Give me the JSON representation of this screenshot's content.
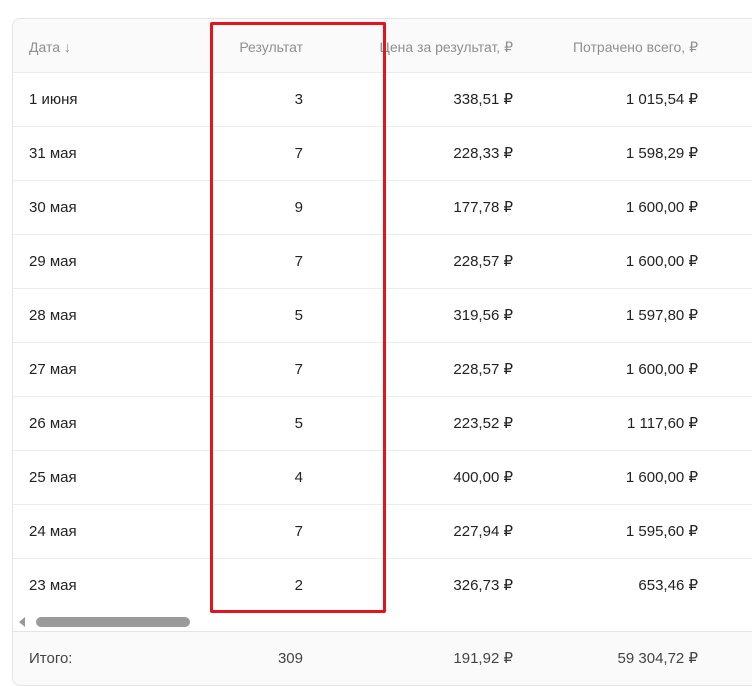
{
  "table": {
    "headers": {
      "date": "Дата ↓",
      "result": "Результат",
      "price": "Цена за результат, ₽",
      "spent": "Потрачено всего, ₽"
    },
    "rows": [
      {
        "date": "1 июня",
        "result": "3",
        "price": "338,51 ₽",
        "spent": "1 015,54 ₽"
      },
      {
        "date": "31 мая",
        "result": "7",
        "price": "228,33 ₽",
        "spent": "1 598,29 ₽"
      },
      {
        "date": "30 мая",
        "result": "9",
        "price": "177,78 ₽",
        "spent": "1 600,00 ₽"
      },
      {
        "date": "29 мая",
        "result": "7",
        "price": "228,57 ₽",
        "spent": "1 600,00 ₽"
      },
      {
        "date": "28 мая",
        "result": "5",
        "price": "319,56 ₽",
        "spent": "1 597,80 ₽"
      },
      {
        "date": "27 мая",
        "result": "7",
        "price": "228,57 ₽",
        "spent": "1 600,00 ₽"
      },
      {
        "date": "26 мая",
        "result": "5",
        "price": "223,52 ₽",
        "spent": "1 117,60 ₽"
      },
      {
        "date": "25 мая",
        "result": "4",
        "price": "400,00 ₽",
        "spent": "1 600,00 ₽"
      },
      {
        "date": "24 мая",
        "result": "7",
        "price": "227,94 ₽",
        "spent": "1 595,60 ₽"
      },
      {
        "date": "23 мая",
        "result": "2",
        "price": "326,73 ₽",
        "spent": "653,46 ₽"
      }
    ],
    "totals": {
      "label": "Итого:",
      "result": "309",
      "price": "191,92 ₽",
      "spent": "59 304,72 ₽"
    }
  },
  "scrollbar": {
    "left_arrow_icon": "triangle-left-icon"
  },
  "colors": {
    "highlight": "#e3141c",
    "header_text": "#8f8f8f",
    "scroll_thumb": "#9b9b9b"
  }
}
